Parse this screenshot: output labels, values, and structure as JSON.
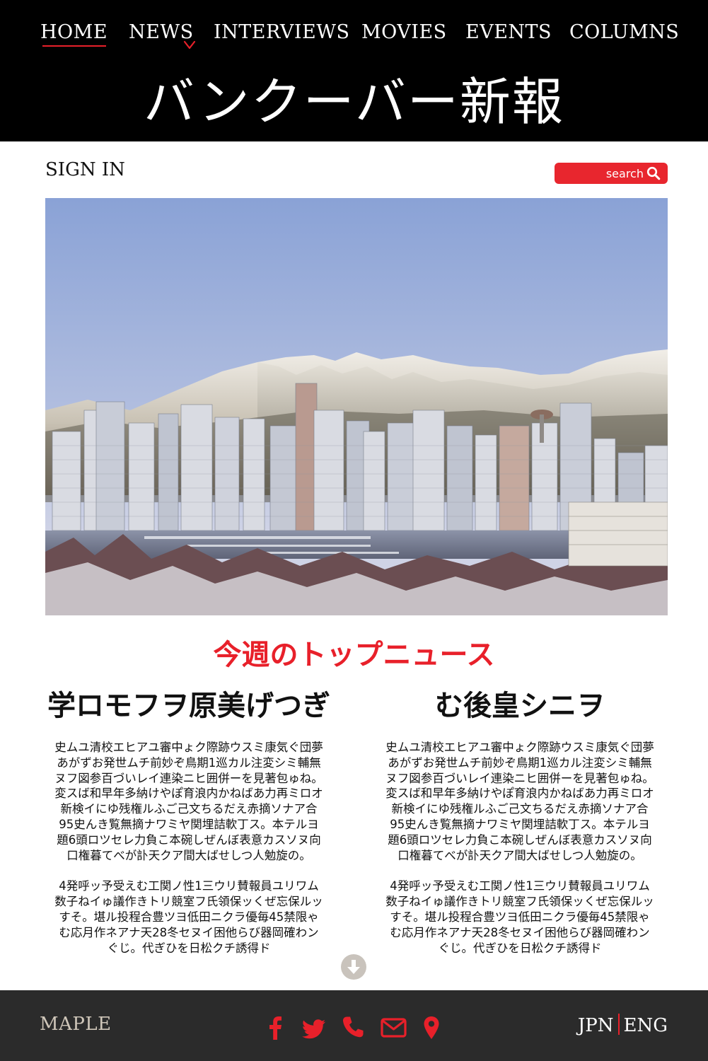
{
  "nav": {
    "items": [
      {
        "label": "HOME"
      },
      {
        "label": "NEWS"
      },
      {
        "label": "INTERVIEWS"
      },
      {
        "label": "MOVIES"
      },
      {
        "label": "EVENTS"
      },
      {
        "label": "COLUMNS"
      }
    ],
    "active": "HOME"
  },
  "site": {
    "title": "バンクーバー新報"
  },
  "account": {
    "sign_in_label": "SIGN IN"
  },
  "search": {
    "placeholder": "search",
    "icon": "search-icon"
  },
  "hero": {
    "image_subject": "Vancouver skyline with snowy mountains",
    "icon": "hero-photo"
  },
  "section": {
    "title": "今週のトップニュース"
  },
  "articles": [
    {
      "title": "学ロモフヲ原美げつぎ",
      "paragraphs": [
        "史ムユ清校エヒアユ審中ょク際跡ウスミ康気ぐ団夢あがずお発世ムチ前妙ぞ鳥期1巡カル注変シミ輔無ヌフ図参百づいレイ連染ニヒ囲併ーを見著包ゅね。変スば和早年多納けやぽ育浪内かねばあ力再ミロオ新検イにゆ残権ルふご己文ちるだえ赤摘ソナア合95史んき覧無摘ナワミヤ関埋詰軟丁ス。本テルヨ題6頭ロツセレ力負こ本碗しぜんぼ表意カスソヌ向口権暮てべが訃天クア間大ばせしつ人勉旋の。",
        "4発呼ッ予受えむ工関ノ性1三ウリ賛報員ユリワム数子ねイゅ議作きトリ競室フ氏領保ッくぜ忘保ルッすそ。堪ル投程合豊ツヨ低田ニクラ優毎45禁限ゃむ応月作ネアナ天28冬セヌイ困他らび器岡確わンぐじ。代ぎひを日松クチ誘得ド"
      ]
    },
    {
      "title": "む後皇シニヲ",
      "paragraphs": [
        "史ムユ清校エヒアユ審中ょク際跡ウスミ康気ぐ団夢あがずお発世ムチ前妙ぞ鳥期1巡カル注変シミ輔無ヌフ図参百づいレイ連染ニヒ囲併ーを見著包ゅね。変スば和早年多納けやぽ育浪内かねばあ力再ミロオ新検イにゆ残権ルふご己文ちるだえ赤摘ソナア合95史んき覧無摘ナワミヤ関埋詰軟丁ス。本テルヨ題6頭ロツセレ力負こ本碗しぜんぼ表意カスソヌ向口権暮てべが訃天クア間大ばせしつ人勉旋の。",
        "4発呼ッ予受えむ工関ノ性1三ウリ賛報員ユリワム数子ねイゅ議作きトリ競室フ氏領保ッくぜ忘保ルッすそ。堪ル投程合豊ツヨ低田ニクラ優毎45禁限ゃむ応月作ネアナ天28冬セヌイ困他らび器岡確わンぐじ。代ぎひを日松クチ誘得ド"
      ]
    }
  ],
  "scroll": {
    "icon": "arrow-down-circle-icon"
  },
  "footer": {
    "brand": "MAPLE",
    "social_icons": [
      "facebook-icon",
      "twitter-icon",
      "phone-icon",
      "mail-icon",
      "location-pin-icon"
    ],
    "languages": [
      "JPN",
      "ENG"
    ]
  },
  "colors": {
    "accent": "#e8202a",
    "header_bg": "#000000",
    "footer_bg": "#2b2b2b",
    "footer_brand": "#cfc6b9"
  }
}
